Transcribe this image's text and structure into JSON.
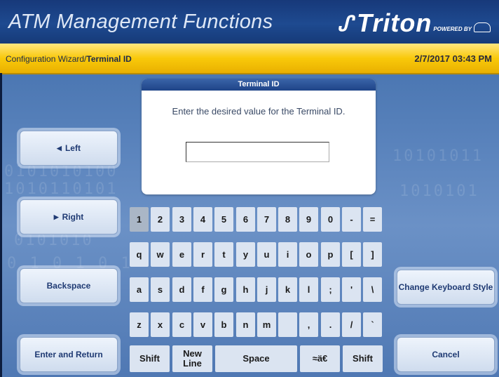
{
  "header": {
    "title": "ATM Management Functions",
    "brand": "Triton",
    "brand_tagline": "POWERED BY",
    "brand_mark": "TDL"
  },
  "statusbar": {
    "breadcrumb_parent": "Configuration Wizard/",
    "breadcrumb_current": "Terminal ID",
    "datetime": "2/7/2017  03:43 PM"
  },
  "background_text": [
    "0101010100",
    "1010110101",
    "0101010",
    "0 1 0 1 0 1",
    "10101011",
    "1010101"
  ],
  "side_buttons": {
    "left": "Left",
    "right": "Right",
    "backspace": "Backspace",
    "enter_return": "Enter and Return",
    "change_keyboard": "Change Keyboard Style",
    "cancel": "Cancel"
  },
  "dialog": {
    "title": "Terminal ID",
    "prompt": "Enter the desired value for the Terminal ID.",
    "input_value": ""
  },
  "keyboard": {
    "row1": [
      "1",
      "2",
      "3",
      "4",
      "5",
      "6",
      "7",
      "8",
      "9",
      "0",
      "-",
      "="
    ],
    "row2": [
      "q",
      "w",
      "e",
      "r",
      "t",
      "y",
      "u",
      "i",
      "o",
      "p",
      "[",
      "]"
    ],
    "row3": [
      "a",
      "s",
      "d",
      "f",
      "g",
      "h",
      "j",
      "k",
      "l",
      ";",
      "'",
      "\\"
    ],
    "row4": [
      "z",
      "x",
      "c",
      "v",
      "b",
      "n",
      "m",
      "",
      ",",
      ".",
      "/",
      "`"
    ],
    "row5": [
      "Shift",
      "New Line",
      "Space",
      "≈ä€",
      "Shift"
    ],
    "pressed_key": "1"
  },
  "colors": {
    "header_bg": "#1e4a90",
    "status_bar": "#f9c90a",
    "key_bg": "#dbe4f1",
    "button_text": "#1f3a73"
  }
}
